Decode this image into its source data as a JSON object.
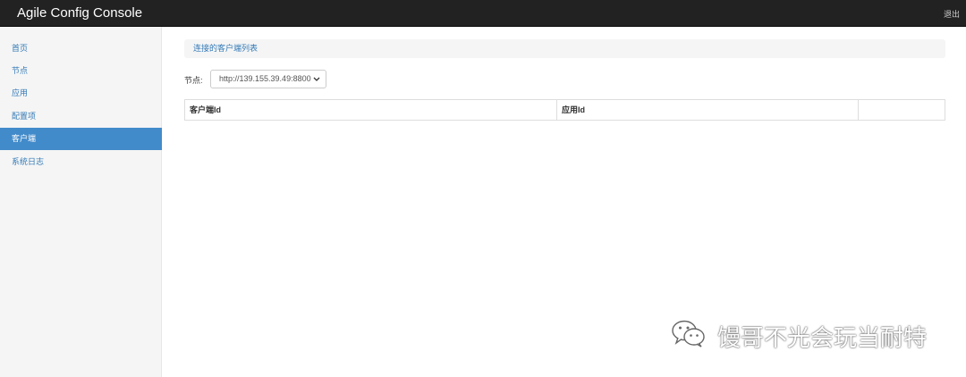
{
  "header": {
    "app_title": "Agile Config Console",
    "logout_label": "退出"
  },
  "sidebar": {
    "items": [
      {
        "label": "首页"
      },
      {
        "label": "节点"
      },
      {
        "label": "应用"
      },
      {
        "label": "配置项"
      },
      {
        "label": "客户端",
        "active": true
      },
      {
        "label": "系统日志"
      }
    ]
  },
  "main": {
    "panel_title": "连接的客户端列表",
    "node_filter": {
      "label": "节点:",
      "selected_value": "http://139.155.39.49:8800"
    },
    "table": {
      "columns": [
        "客户端Id",
        "应用Id",
        ""
      ]
    }
  },
  "watermark": {
    "text": "馒哥不光会玩当耐特"
  },
  "colors": {
    "topbar": "#222222",
    "sidebar_bg": "#f5f5f5",
    "active_item": "#428bca",
    "link": "#337ab7"
  }
}
